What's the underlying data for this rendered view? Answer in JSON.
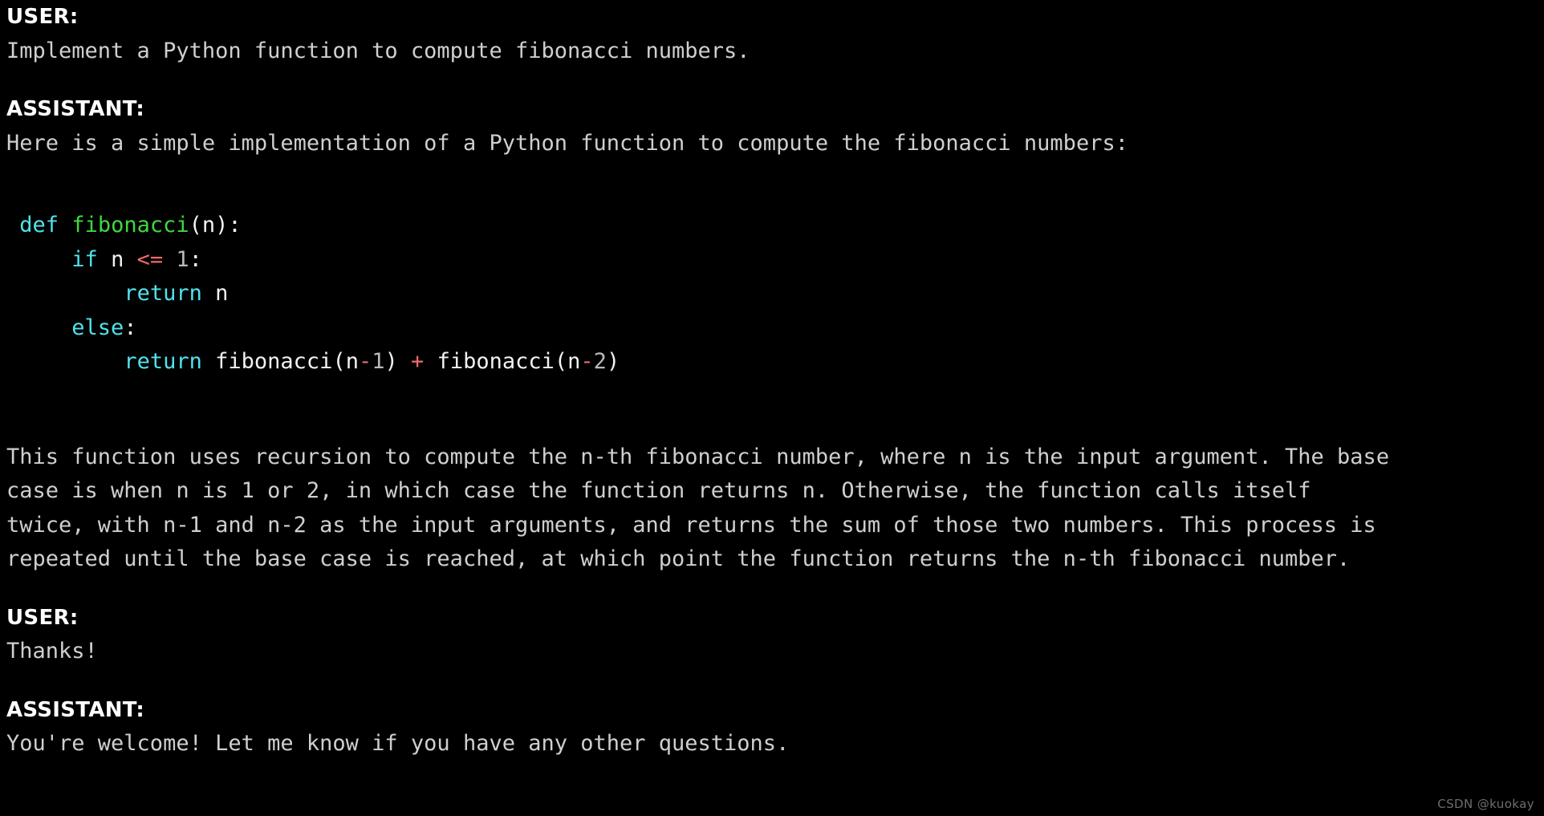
{
  "background_color": "#000000",
  "colors": {
    "body_text": "#cfcfcf",
    "role_label": "#ffffff",
    "keyword": "#4fe3ec",
    "function_name": "#3fd83f",
    "operator": "#ef6a6a",
    "number": "#b9b9b9",
    "punctuation": "#f2f2f2",
    "watermark": "#6d6d6d"
  },
  "turns": {
    "user_1": {
      "role_label": "USER:",
      "message": "Implement a Python function to compute fibonacci numbers."
    },
    "assistant_1": {
      "role_label": "ASSISTANT:",
      "intro": "Here is a simple implementation of a Python function to compute the fibonacci numbers:",
      "code": {
        "language": "python",
        "lines": [
          {
            "tokens": [
              {
                "text": " ",
                "type": "plain"
              },
              {
                "text": "def",
                "type": "keyword"
              },
              {
                "text": " ",
                "type": "plain"
              },
              {
                "text": "fibonacci",
                "type": "function_name"
              },
              {
                "text": "(",
                "type": "punctuation"
              },
              {
                "text": "n",
                "type": "variable"
              },
              {
                "text": "):",
                "type": "punctuation"
              }
            ]
          },
          {
            "tokens": [
              {
                "text": "     ",
                "type": "plain"
              },
              {
                "text": "if",
                "type": "keyword"
              },
              {
                "text": " ",
                "type": "plain"
              },
              {
                "text": "n",
                "type": "variable"
              },
              {
                "text": " ",
                "type": "plain"
              },
              {
                "text": "<=",
                "type": "operator"
              },
              {
                "text": " ",
                "type": "plain"
              },
              {
                "text": "1",
                "type": "number"
              },
              {
                "text": ":",
                "type": "punctuation"
              }
            ]
          },
          {
            "tokens": [
              {
                "text": "         ",
                "type": "plain"
              },
              {
                "text": "return",
                "type": "keyword"
              },
              {
                "text": " ",
                "type": "plain"
              },
              {
                "text": "n",
                "type": "variable"
              }
            ]
          },
          {
            "tokens": [
              {
                "text": "     ",
                "type": "plain"
              },
              {
                "text": "else",
                "type": "keyword"
              },
              {
                "text": ":",
                "type": "punctuation"
              }
            ]
          },
          {
            "tokens": [
              {
                "text": "         ",
                "type": "plain"
              },
              {
                "text": "return",
                "type": "keyword"
              },
              {
                "text": " ",
                "type": "plain"
              },
              {
                "text": "fibonacci",
                "type": "punctuation"
              },
              {
                "text": "(",
                "type": "punctuation"
              },
              {
                "text": "n",
                "type": "variable"
              },
              {
                "text": "-",
                "type": "operator"
              },
              {
                "text": "1",
                "type": "number"
              },
              {
                "text": ")",
                "type": "punctuation"
              },
              {
                "text": " ",
                "type": "plain"
              },
              {
                "text": "+",
                "type": "operator"
              },
              {
                "text": " ",
                "type": "plain"
              },
              {
                "text": "fibonacci",
                "type": "punctuation"
              },
              {
                "text": "(",
                "type": "punctuation"
              },
              {
                "text": "n",
                "type": "variable"
              },
              {
                "text": "-",
                "type": "operator"
              },
              {
                "text": "2",
                "type": "number"
              },
              {
                "text": ")",
                "type": "punctuation"
              }
            ]
          }
        ]
      },
      "explanation_lines": [
        "This function uses recursion to compute the n-th fibonacci number, where n is the input argument. The base",
        "case is when n is 1 or 2, in which case the function returns n. Otherwise, the function calls itself",
        "twice, with n-1 and n-2 as the input arguments, and returns the sum of those two numbers. This process is",
        "repeated until the base case is reached, at which point the function returns the n-th fibonacci number."
      ]
    },
    "user_2": {
      "role_label": "USER:",
      "message": "Thanks!"
    },
    "assistant_2": {
      "role_label": "ASSISTANT:",
      "message": "You're welcome! Let me know if you have any other questions."
    }
  },
  "watermark": {
    "text": "CSDN @kuokay"
  }
}
